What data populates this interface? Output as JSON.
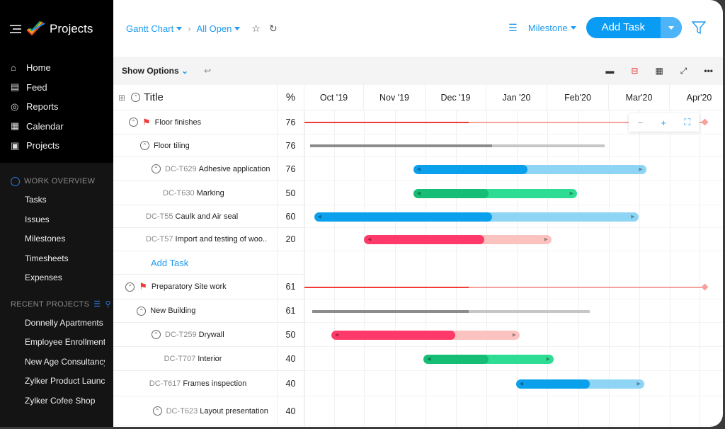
{
  "app": {
    "title": "Projects"
  },
  "sidebar": {
    "nav": [
      {
        "label": "Home",
        "icon": "home-icon"
      },
      {
        "label": "Feed",
        "icon": "feed-icon"
      },
      {
        "label": "Reports",
        "icon": "reports-icon"
      },
      {
        "label": "Calendar",
        "icon": "calendar-icon"
      },
      {
        "label": "Projects",
        "icon": "projects-icon"
      }
    ],
    "work_overview": {
      "title": "WORK OVERVIEW",
      "items": [
        "Tasks",
        "Issues",
        "Milestones",
        "Timesheets",
        "Expenses"
      ]
    },
    "recent": {
      "title": "RECENT PROJECTS",
      "items": [
        "Donnelly Apartments",
        "Employee Enrollment",
        "New Age Consultancy",
        "Zylker Product Launch",
        "Zylker Cofee Shop"
      ]
    }
  },
  "header": {
    "view": "Gantt Chart",
    "filter": "All Open",
    "group": "Milestone",
    "add_task": "Add Task"
  },
  "toolbar": {
    "show_options": "Show Options"
  },
  "grid": {
    "title_header": "Title",
    "pct_header": "%",
    "add_task": "Add Task"
  },
  "timeline": {
    "months": [
      "Oct '19",
      "Nov '19",
      "Dec '19",
      "Jan '20",
      "Feb'20",
      "Mar'20",
      "Apr'20"
    ],
    "zoom": {
      "minus": "−",
      "plus": "+"
    }
  },
  "colors": {
    "blue": [
      "#0aa0ec",
      "#8ed4f4"
    ],
    "green": [
      "#15bd75",
      "#2fdc93"
    ],
    "pink": [
      "#ff3a6a",
      "#fbc3c0"
    ],
    "gray": [
      "#8c8c8c",
      "#c6c6c6"
    ],
    "red": [
      "#ef3a35",
      "#f7a19d"
    ]
  },
  "rows": [
    {
      "id": "",
      "title": "Floor finishes",
      "pct": "76",
      "level": 0,
      "collapse": true,
      "milestone": true,
      "bar": {
        "type": "milestone",
        "color": "red",
        "start": "2019-10-01",
        "end": "2020-04-19",
        "progress_end": "2019-12-23"
      }
    },
    {
      "id": "",
      "title": "Floor tiling",
      "pct": "76",
      "level": 1,
      "collapse": true,
      "bar": {
        "type": "summary",
        "color": "gray",
        "start": "2019-10-04",
        "end": "2020-02-28",
        "progress_end": "2020-01-04"
      }
    },
    {
      "id": "DC-T629",
      "title": "Adhesive application",
      "pct": "76",
      "level": 2,
      "collapse": true,
      "bar": {
        "type": "task",
        "color": "blue",
        "start": "2019-11-25",
        "end": "2020-03-20",
        "progress_end": "2020-01-22"
      }
    },
    {
      "id": "DC-T630",
      "title": "Marking",
      "pct": "50",
      "level": 3,
      "bar": {
        "type": "task",
        "color": "green",
        "start": "2019-11-25",
        "end": "2020-02-15",
        "progress_end": "2020-01-02"
      }
    },
    {
      "id": "DC-T55",
      "title": "Caulk and Air seal",
      "pct": "60",
      "level": 1.5,
      "bar": {
        "type": "task",
        "color": "blue",
        "start": "2019-10-06",
        "end": "2020-03-16",
        "progress_end": "2020-01-04"
      }
    },
    {
      "id": "DC-T57",
      "title": "Import and testing of woo..",
      "pct": "20",
      "level": 1.5,
      "bar": {
        "type": "task",
        "color": "pink",
        "start": "2019-11-01",
        "end": "2020-02-03",
        "progress_end": "2019-12-31"
      }
    },
    {
      "addtask": true
    },
    {
      "id": "",
      "title": "Preparatory Site work",
      "pct": "61",
      "level": -0.3,
      "collapse": true,
      "milestone": true,
      "bar": {
        "type": "milestone",
        "color": "red",
        "start": "2019-10-01",
        "end": "2020-04-19",
        "progress_end": "2019-12-23"
      }
    },
    {
      "id": "",
      "title": "New Building",
      "pct": "61",
      "level": 0.7,
      "collapse": true,
      "bar": {
        "type": "summary",
        "color": "gray",
        "start": "2019-10-05",
        "end": "2020-02-21",
        "progress_end": "2019-12-23"
      }
    },
    {
      "id": "DC-T259",
      "title": "Drywall",
      "pct": "50",
      "level": 2,
      "collapse": true,
      "bar": {
        "type": "task",
        "color": "pink",
        "start": "2019-10-15",
        "end": "2020-01-18",
        "progress_end": "2019-12-16"
      }
    },
    {
      "id": "DC-T707",
      "title": "Interior",
      "pct": "40",
      "level": 3.1,
      "bar": {
        "type": "task",
        "color": "green",
        "start": "2019-11-30",
        "end": "2020-02-04",
        "progress_end": "2020-01-02"
      }
    },
    {
      "id": "DC-T617",
      "title": "Frames inspection",
      "pct": "40",
      "level": 1.8,
      "bar": {
        "type": "task",
        "color": "blue",
        "start": "2020-01-16",
        "end": "2020-03-19",
        "progress_end": "2020-02-21"
      }
    },
    {
      "id": "DC-T623",
      "title": "Layout presentation",
      "pct": "40",
      "level": 2.1,
      "collapse": true
    }
  ]
}
